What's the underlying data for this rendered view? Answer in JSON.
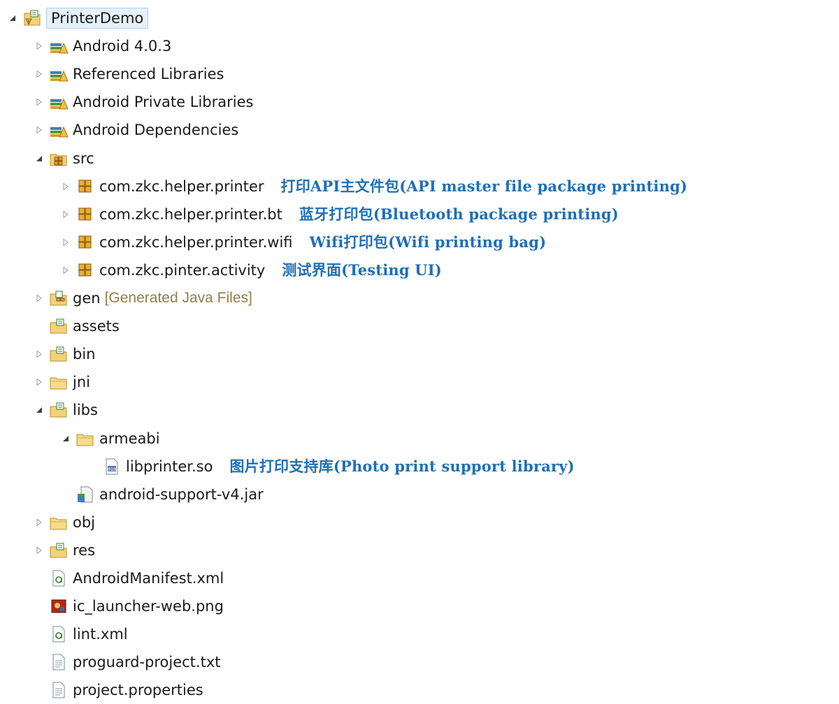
{
  "tree": [
    {
      "level": 0,
      "toggle": "expanded",
      "icon": "project-icon",
      "label": "PrinterDemo",
      "selected": true
    },
    {
      "level": 1,
      "toggle": "collapsed",
      "icon": "library-icon",
      "label": "Android 4.0.3"
    },
    {
      "level": 1,
      "toggle": "collapsed",
      "icon": "library-icon",
      "label": "Referenced Libraries"
    },
    {
      "level": 1,
      "toggle": "collapsed",
      "icon": "library-icon",
      "label": "Android Private Libraries"
    },
    {
      "level": 1,
      "toggle": "collapsed",
      "icon": "library-icon",
      "label": "Android Dependencies"
    },
    {
      "level": 1,
      "toggle": "expanded",
      "icon": "source-folder-icon",
      "label": "src"
    },
    {
      "level": 2,
      "toggle": "collapsed",
      "icon": "package-icon",
      "label": "com.zkc.helper.printer",
      "note": "打印API主文件包(API master file package printing)"
    },
    {
      "level": 2,
      "toggle": "collapsed",
      "icon": "package-icon",
      "label": "com.zkc.helper.printer.bt",
      "note": "蓝牙打印包(Bluetooth package printing)"
    },
    {
      "level": 2,
      "toggle": "collapsed",
      "icon": "package-icon",
      "label": "com.zkc.helper.printer.wifi",
      "note": "Wifi打印包(Wifi printing bag)"
    },
    {
      "level": 2,
      "toggle": "collapsed",
      "icon": "package-icon",
      "label": "com.zkc.pinter.activity",
      "note": "测试界面(Testing UI)"
    },
    {
      "level": 1,
      "toggle": "collapsed",
      "icon": "gen-folder-icon",
      "label": "gen",
      "decoration": "[Generated Java Files]"
    },
    {
      "level": 1,
      "toggle": "none",
      "icon": "folder-icon",
      "label": "assets"
    },
    {
      "level": 1,
      "toggle": "collapsed",
      "icon": "folder-icon",
      "label": "bin"
    },
    {
      "level": 1,
      "toggle": "collapsed",
      "icon": "plain-folder-icon",
      "label": "jni"
    },
    {
      "level": 1,
      "toggle": "expanded",
      "icon": "folder-icon",
      "label": "libs"
    },
    {
      "level": 2,
      "toggle": "expanded",
      "icon": "plain-folder-icon",
      "label": "armeabi"
    },
    {
      "level": 3,
      "toggle": "none",
      "icon": "binary-file-icon",
      "label": "libprinter.so",
      "note": "图片打印支持库(Photo print support library)"
    },
    {
      "level": 2,
      "toggle": "none",
      "icon": "jar-icon",
      "label": "android-support-v4.jar"
    },
    {
      "level": 1,
      "toggle": "collapsed",
      "icon": "plain-folder-icon",
      "label": "obj"
    },
    {
      "level": 1,
      "toggle": "collapsed",
      "icon": "folder-icon",
      "label": "res"
    },
    {
      "level": 1,
      "toggle": "none",
      "icon": "xml-file-icon",
      "label": "AndroidManifest.xml"
    },
    {
      "level": 1,
      "toggle": "none",
      "icon": "image-file-icon",
      "label": "ic_launcher-web.png"
    },
    {
      "level": 1,
      "toggle": "none",
      "icon": "xml-file-icon",
      "label": "lint.xml"
    },
    {
      "level": 1,
      "toggle": "none",
      "icon": "text-file-icon",
      "label": "proguard-project.txt"
    },
    {
      "level": 1,
      "toggle": "none",
      "icon": "text-file-icon",
      "label": "project.properties"
    }
  ]
}
